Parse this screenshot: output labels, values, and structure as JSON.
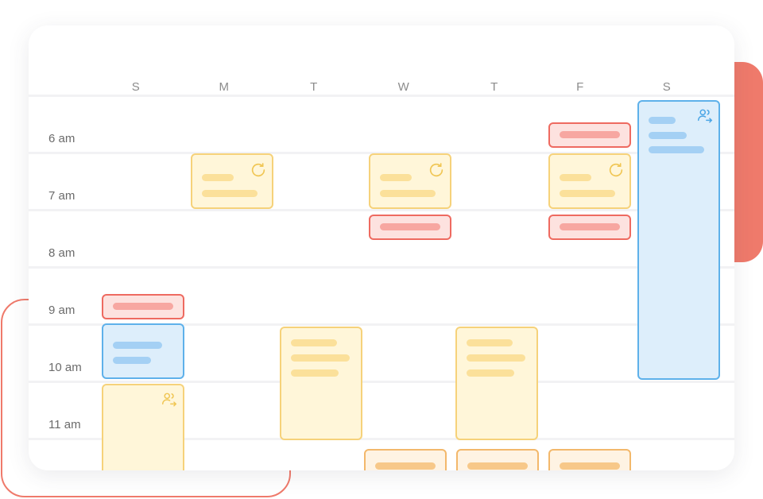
{
  "calendar": {
    "days": [
      "S",
      "M",
      "T",
      "W",
      "T",
      "F",
      "S"
    ],
    "times": [
      "6 am",
      "7 am",
      "8 am",
      "9 am",
      "10 am",
      "11 am"
    ]
  },
  "colors": {
    "accent_coral": "#ef7a6b",
    "event_yellow": "#f6d27a",
    "event_red": "#ee6a60",
    "event_blue": "#5eb1ea",
    "event_orange": "#f3b86b"
  },
  "icons": {
    "recurring": "refresh-icon",
    "shared": "people-icon"
  }
}
